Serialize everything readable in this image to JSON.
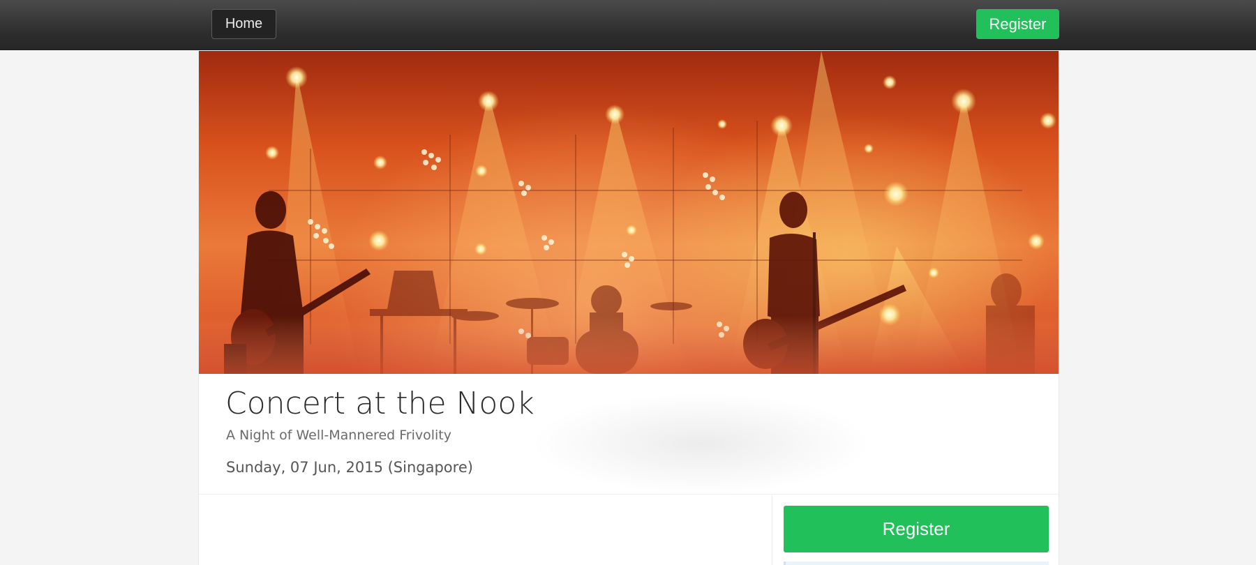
{
  "nav": {
    "home_label": "Home",
    "register_label": "Register"
  },
  "hero": {
    "image_icon": "concert-photo"
  },
  "event": {
    "title": "Concert at the Nook",
    "subtitle": "A Night of Well-Mannered Frivolity",
    "date": "Sunday, 07 Jun, 2015 (Singapore)"
  },
  "sidebar": {
    "register_label": "Register"
  },
  "colors": {
    "accent_green": "#22c05a",
    "topbar_dark": "#2c2c2c"
  }
}
